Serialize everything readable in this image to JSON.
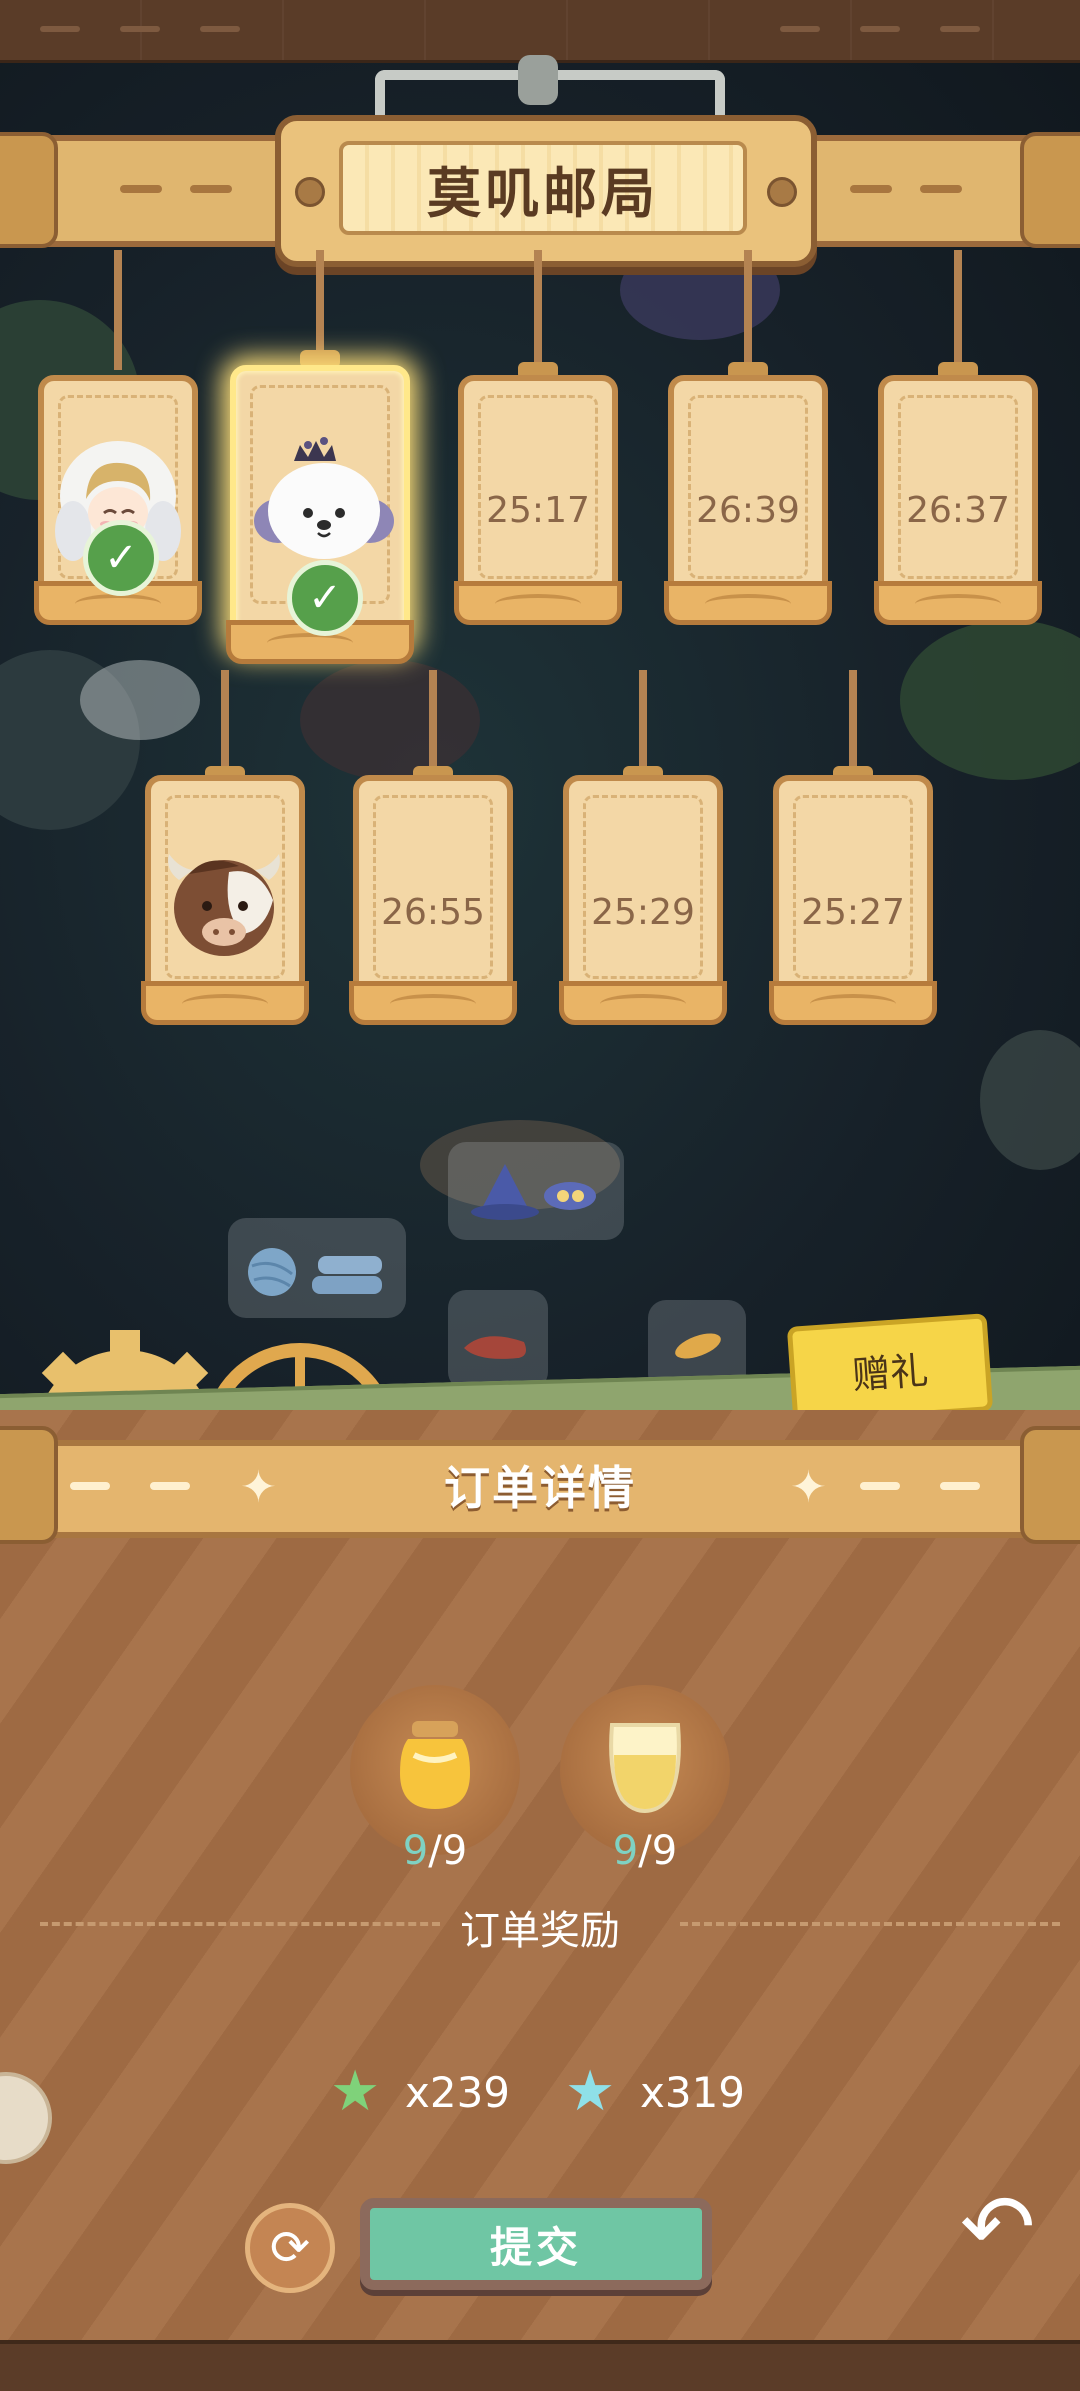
{
  "header": {
    "title": "莫叽邮局"
  },
  "orders": {
    "row1": [
      {
        "kind": "character",
        "character": "blonde-girl-in-white-hood",
        "completed": true
      },
      {
        "kind": "character",
        "character": "white-puppy-with-crown",
        "completed": true,
        "selected": true
      },
      {
        "kind": "timer",
        "timer": "25:17"
      },
      {
        "kind": "timer",
        "timer": "26:39"
      },
      {
        "kind": "timer",
        "timer": "26:37"
      }
    ],
    "row2": [
      {
        "kind": "character",
        "character": "brown-cow"
      },
      {
        "kind": "timer",
        "timer": "26:55"
      },
      {
        "kind": "timer",
        "timer": "25:29"
      },
      {
        "kind": "timer",
        "timer": "25:27"
      }
    ]
  },
  "gift_button": {
    "label": "赠礼"
  },
  "order_details": {
    "title": "订单详情",
    "items": [
      {
        "icon": "honey-jar-icon",
        "have": "9",
        "need": "/9"
      },
      {
        "icon": "juice-glass-icon",
        "have": "9",
        "need": "/9"
      }
    ],
    "reward_label": "订单奖励",
    "rewards": [
      {
        "icon": "green-star-icon",
        "amount": "x239",
        "color": "#7fd27a"
      },
      {
        "icon": "blue-star-icon",
        "amount": "x319",
        "color": "#8fe0e8"
      }
    ]
  },
  "actions": {
    "refresh_icon": "refresh-icon",
    "submit_label": "提交",
    "back_icon": "back-arrow-icon"
  },
  "colors": {
    "accent_green": "#6fc6a4",
    "check_green": "#56a04b",
    "count_teal": "#7fd2c3"
  }
}
